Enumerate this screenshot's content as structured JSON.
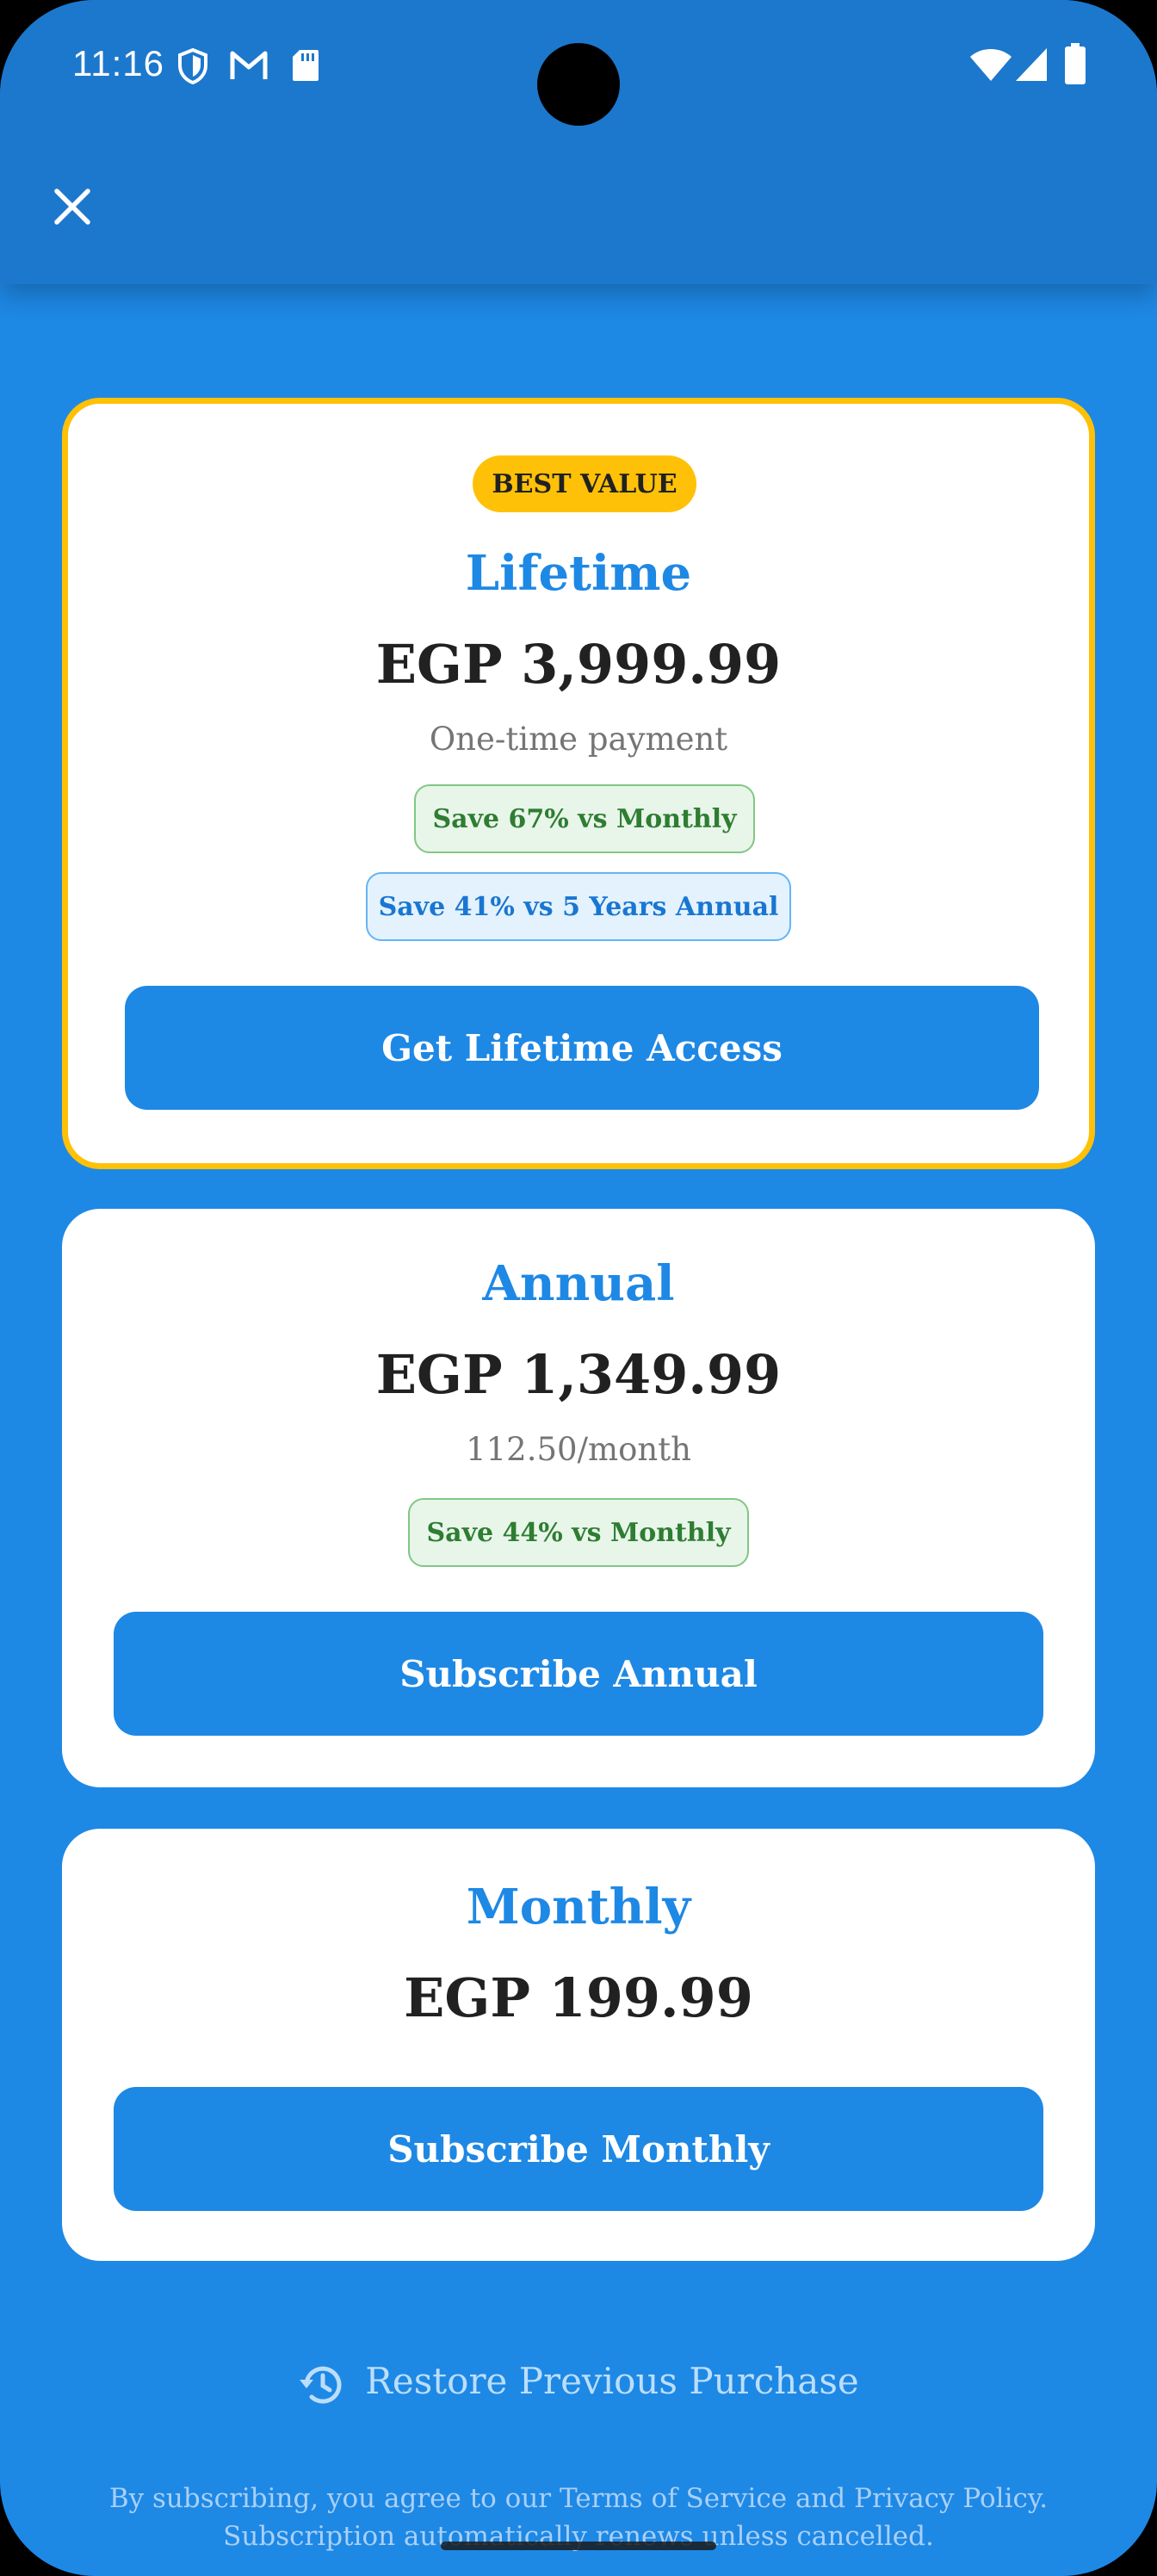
{
  "status_bar": {
    "time": "11:16",
    "left_icons": [
      "shield-icon",
      "gmail-icon",
      "sd-card-icon"
    ],
    "right_icons": [
      "wifi-icon",
      "signal-icon",
      "battery-icon"
    ]
  },
  "app_bar": {
    "close_icon": "close-icon"
  },
  "plans": {
    "lifetime": {
      "badge": "BEST VALUE",
      "title": "Lifetime",
      "price": "EGP 3,999.99",
      "subtitle": "One-time payment",
      "chips": [
        "Save 67% vs Monthly",
        "Save 41% vs 5 Years Annual"
      ],
      "button": "Get Lifetime Access"
    },
    "annual": {
      "title": "Annual",
      "price": "EGP 1,349.99",
      "subtitle": "112.50/month",
      "chip": "Save 44% vs Monthly",
      "button": "Subscribe Annual"
    },
    "monthly": {
      "title": "Monthly",
      "price": "EGP 199.99",
      "button": "Subscribe Monthly"
    }
  },
  "restore": {
    "icon": "restore-history-icon",
    "label": "Restore Previous Purchase"
  },
  "legal": {
    "line1": "By subscribing, you agree to our Terms of Service and Privacy Policy.",
    "line2": "Subscription automatically renews unless cancelled."
  },
  "colors": {
    "background": "#1E88E5",
    "app_bar": "#1C78CC",
    "accent": "#1E88E5",
    "best_value": "#FFC107",
    "save_green": "#2E7D32",
    "save_blue": "#1976D2"
  }
}
